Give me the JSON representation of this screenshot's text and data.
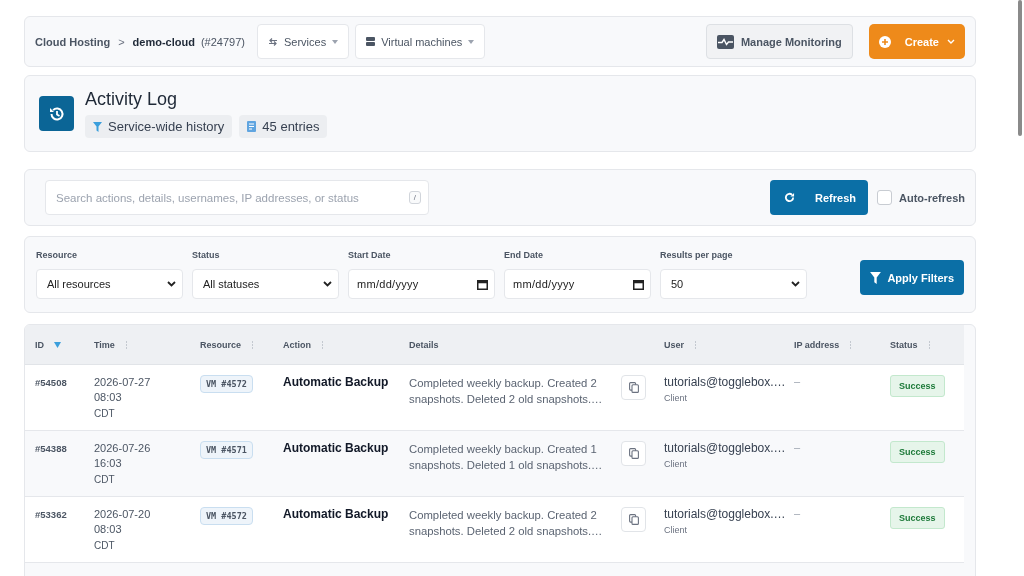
{
  "breadcrumb": {
    "parent": "Cloud Hosting",
    "separator": ">",
    "current": "demo-cloud",
    "id": "(#24797)"
  },
  "nav_dropdowns": [
    {
      "label": "Services",
      "kind": "swap"
    },
    {
      "label": "Virtual machines",
      "kind": "server"
    }
  ],
  "header_buttons": [
    {
      "label": "Manage Monitoring",
      "kind": "secondary"
    },
    {
      "label": "Create",
      "kind": "primary"
    }
  ],
  "page": {
    "title": "Activity Log",
    "chips": [
      {
        "label": "Service-wide history",
        "kind": "filter"
      },
      {
        "label": "45 entries",
        "kind": "list"
      }
    ]
  },
  "search": {
    "placeholder": "Search actions, details, usernames, IP addresses, or status",
    "shortcut": "/"
  },
  "refresh_button": "Refresh",
  "auto_refresh": {
    "label": "Auto-refresh",
    "checked": false
  },
  "filters": [
    {
      "label": "Resource",
      "kind": "select",
      "value": "All resources"
    },
    {
      "label": "Status",
      "kind": "select",
      "value": "All statuses"
    },
    {
      "label": "Start Date",
      "kind": "date",
      "value": "mm/dd/yyyy"
    },
    {
      "label": "End Date",
      "kind": "date",
      "value": "mm/dd/yyyy"
    },
    {
      "label": "Results per page",
      "kind": "select",
      "value": "50"
    }
  ],
  "apply_button": "Apply Filters",
  "table": {
    "columns": [
      {
        "label": "ID",
        "sorted": true
      },
      {
        "label": "Time",
        "sorted": false
      },
      {
        "label": "Resource",
        "sorted": false
      },
      {
        "label": "Action",
        "sorted": false
      },
      {
        "label": "Details"
      },
      {
        "label": "User",
        "sorted": false
      },
      {
        "label": "IP address",
        "sorted": false
      },
      {
        "label": "Status",
        "sorted": false
      }
    ],
    "rows": [
      {
        "id": "#54508",
        "date": "2026-07-27",
        "time": "08:03",
        "tz": "CDT",
        "resource": "VM #4572",
        "action": "Automatic Backup",
        "details": "Completed weekly backup. Created 2 snapshots. Deleted 2 old snapshots.…",
        "user": "tutorials@togglebox.…",
        "role": "Client",
        "ip": "–",
        "status": "Success"
      },
      {
        "id": "#54388",
        "date": "2026-07-26",
        "time": "16:03",
        "tz": "CDT",
        "resource": "VM #4571",
        "action": "Automatic Backup",
        "details": "Completed weekly backup. Created 1 snapshots. Deleted 1 old snapshots.…",
        "user": "tutorials@togglebox.…",
        "role": "Client",
        "ip": "–",
        "status": "Success"
      },
      {
        "id": "#53362",
        "date": "2026-07-20",
        "time": "08:03",
        "tz": "CDT",
        "resource": "VM #4572",
        "action": "Automatic Backup",
        "details": "Completed weekly backup. Created 2 snapshots. Deleted 2 old snapshots.…",
        "user": "tutorials@togglebox.…",
        "role": "Client",
        "ip": "–",
        "status": "Success"
      }
    ]
  }
}
